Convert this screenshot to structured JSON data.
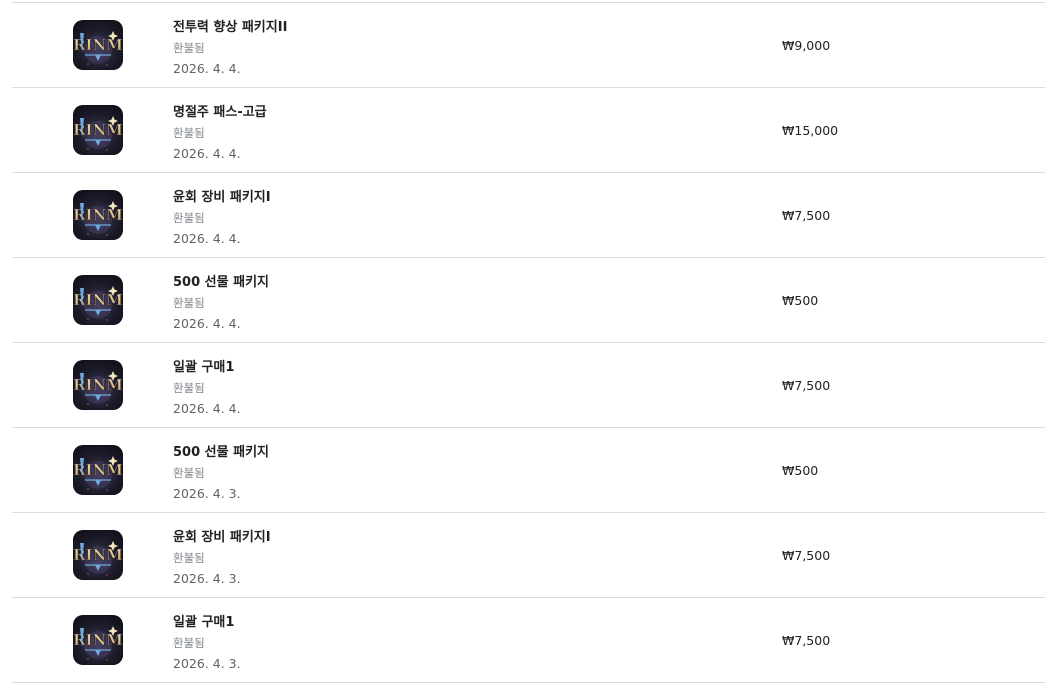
{
  "purchases": [
    {
      "title": "전투력 향상 패키지II",
      "status": "환불됨",
      "date": "2026. 4. 4.",
      "price": "₩9,000",
      "icon": "rinm-app-icon"
    },
    {
      "title": "명절주 패스-고급",
      "status": "환불됨",
      "date": "2026. 4. 4.",
      "price": "₩15,000",
      "icon": "rinm-app-icon"
    },
    {
      "title": "윤회 장비 패키지I",
      "status": "환불됨",
      "date": "2026. 4. 4.",
      "price": "₩7,500",
      "icon": "rinm-app-icon"
    },
    {
      "title": "500 선물 패키지",
      "status": "환불됨",
      "date": "2026. 4. 4.",
      "price": "₩500",
      "icon": "rinm-app-icon"
    },
    {
      "title": "일괄 구매1",
      "status": "환불됨",
      "date": "2026. 4. 4.",
      "price": "₩7,500",
      "icon": "rinm-app-icon"
    },
    {
      "title": "500 선물 패키지",
      "status": "환불됨",
      "date": "2026. 4. 3.",
      "price": "₩500",
      "icon": "rinm-app-icon"
    },
    {
      "title": "윤회 장비 패키지I",
      "status": "환불됨",
      "date": "2026. 4. 3.",
      "price": "₩7,500",
      "icon": "rinm-app-icon"
    },
    {
      "title": "일괄 구매1",
      "status": "환불됨",
      "date": "2026. 4. 3.",
      "price": "₩7,500",
      "icon": "rinm-app-icon"
    }
  ],
  "logo_text": "RINM",
  "colors": {
    "divider": "#dadce0",
    "title": "#202124",
    "status": "#80868b",
    "date": "#5f6368",
    "icon_bg": "#1b1a28",
    "logo_gold": "#c8a45c",
    "logo_blue": "#6fa8dc"
  }
}
